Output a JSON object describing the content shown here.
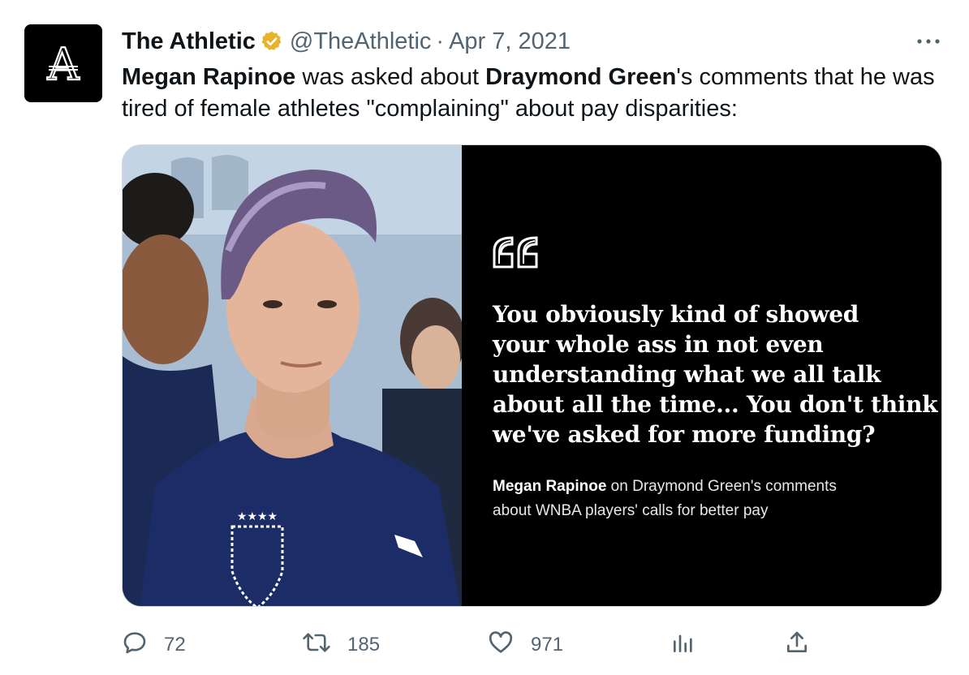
{
  "author": {
    "name": "The Athletic",
    "handle": "@TheAthletic",
    "separator": "·",
    "date": "Apr 7, 2021",
    "avatar_letter": "A"
  },
  "tweet": {
    "part1_bold": "Megan Rapinoe",
    "part2": " was asked about ",
    "part3_bold": "Draymond Green",
    "part4": "'s comments that he was tired of female athletes \"complaining\" about pay disparities:"
  },
  "media": {
    "quote_line1": "You obviously kind of showed",
    "quote_line2": "your whole ass in not even",
    "quote_line3": "understanding what we all talk",
    "quote_line4": "about all the time... You don't think",
    "quote_line5": "we've asked for more funding?",
    "attribution_name": "Megan Rapinoe",
    "attribution_line1_rest": " on Draymond Green's comments",
    "attribution_line2": "about WNBA players' calls for better pay"
  },
  "actions": {
    "replies": "72",
    "retweets": "185",
    "likes": "971"
  },
  "colors": {
    "text": "#0f1419",
    "secondary": "#536471",
    "verified": "#e8b22a"
  },
  "icons": [
    "more-icon",
    "verified-badge-icon",
    "reply-icon",
    "retweet-icon",
    "like-icon",
    "views-icon",
    "share-icon"
  ]
}
